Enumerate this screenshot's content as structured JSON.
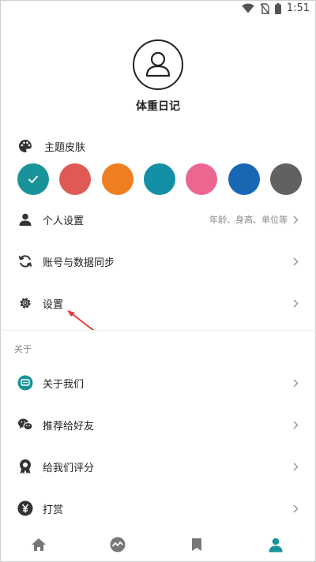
{
  "status_bar": {
    "time": "1:51"
  },
  "profile": {
    "name": "体重日记"
  },
  "theme": {
    "label": "主题皮肤",
    "swatches": [
      {
        "color": "#18939a",
        "selected": true
      },
      {
        "color": "#e05a55",
        "selected": false
      },
      {
        "color": "#f07e22",
        "selected": false
      },
      {
        "color": "#138fa6",
        "selected": false
      },
      {
        "color": "#ec6790",
        "selected": false
      },
      {
        "color": "#1866b4",
        "selected": false
      },
      {
        "color": "#616161",
        "selected": false
      }
    ]
  },
  "menu": {
    "personal_settings": {
      "label": "个人设置",
      "hint": "年龄、身高、单位等"
    },
    "account_sync": {
      "label": "账号与数据同步"
    },
    "settings": {
      "label": "设置"
    }
  },
  "about": {
    "title": "关于",
    "items": [
      {
        "label": "关于我们",
        "icon": "chat-bubble-icon"
      },
      {
        "label": "推荐给好友",
        "icon": "wechat-icon"
      },
      {
        "label": "给我们评分",
        "icon": "rating-icon"
      },
      {
        "label": "打赏",
        "icon": "yen-icon"
      }
    ]
  },
  "bottom_nav": {
    "items": [
      {
        "icon": "home-icon",
        "active": false
      },
      {
        "icon": "trend-icon",
        "active": false
      },
      {
        "icon": "bookmark-icon",
        "active": false
      },
      {
        "icon": "person-icon",
        "active": true
      }
    ]
  },
  "colors": {
    "accent": "#18939a",
    "arrow": "#e53935",
    "icon": "#333333",
    "muted": "#888888"
  }
}
